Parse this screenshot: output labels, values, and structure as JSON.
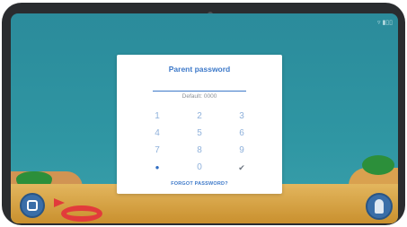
{
  "dialog": {
    "title": "Parent password",
    "default_hint": "Default: 0000",
    "keys": [
      "1",
      "2",
      "3",
      "4",
      "5",
      "6",
      "7",
      "8",
      "9",
      "0"
    ],
    "show_icon": "eye-icon",
    "confirm_icon": "check-icon",
    "forgot_label": "FORGOT PASSWORD?"
  },
  "colors": {
    "accent": "#3d79c9",
    "sea": "#2f96a3",
    "sand": "#e3b65e"
  },
  "bottom_bar": {
    "back_icon": "exit-icon",
    "parent_icon": "parent-icon"
  }
}
